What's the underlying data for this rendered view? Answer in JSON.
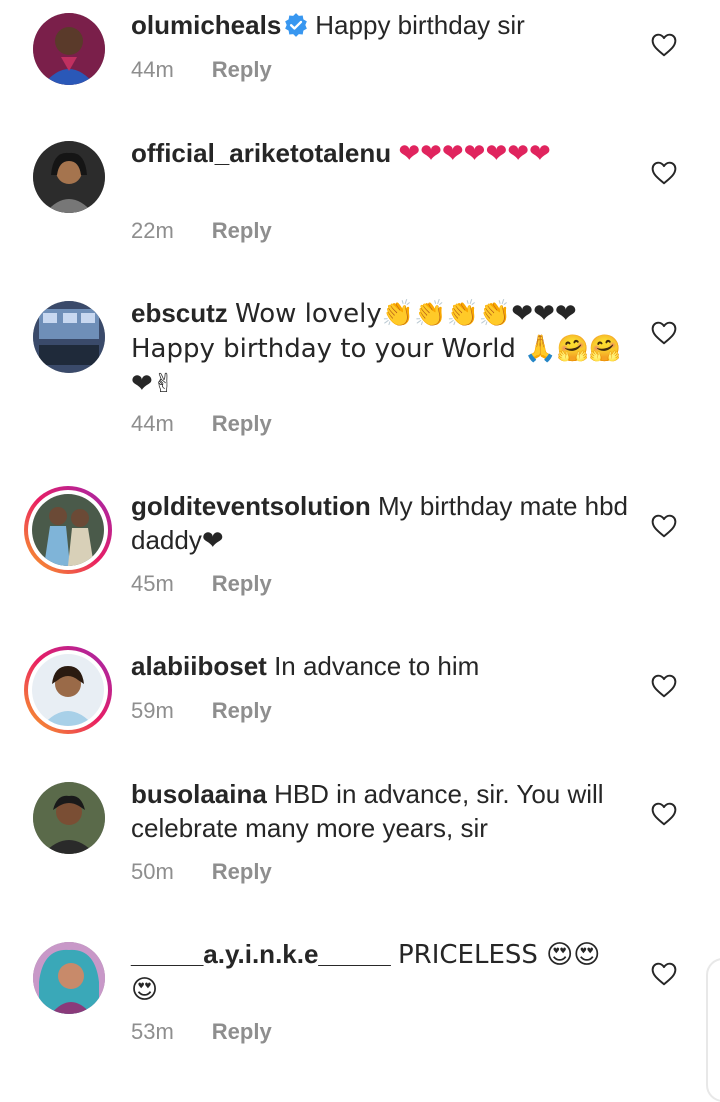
{
  "comments": [
    {
      "username": "olumicheals",
      "verified": true,
      "text": "Happy birthday sir",
      "time": "44m",
      "reply": "Reply"
    },
    {
      "username": "official_ariketotalenu",
      "text": "❤❤❤❤❤❤❤",
      "time": "22m",
      "reply": "Reply"
    },
    {
      "username": "ebscutz",
      "text": "Wow lovely👏👏👏👏❤❤❤ Happy birthday to your World 🙏🤗🤗 ❤✌",
      "time": "44m",
      "reply": "Reply"
    },
    {
      "username": "golditeventsolution",
      "text": "My birthday mate hbd daddy❤",
      "time": "45m",
      "reply": "Reply"
    },
    {
      "username": "alabiiboset",
      "text": "In advance to him",
      "time": "59m",
      "reply": "Reply"
    },
    {
      "username": "busolaaina",
      "text": "HBD in advance, sir. You will celebrate many more years, sir",
      "time": "50m",
      "reply": "Reply"
    },
    {
      "username": "_____a.y.i.n.k.e_____",
      "text": "PRICELESS 😍😍 😍",
      "time": "53m",
      "reply": "Reply"
    }
  ],
  "colors": {
    "username": "#262626",
    "meta": "#8e8e8e",
    "verified": "#3897f0",
    "heart_emoji": "#e0245e"
  },
  "icons": {
    "like": "heart-outline-icon",
    "verified": "verified-badge-icon"
  }
}
